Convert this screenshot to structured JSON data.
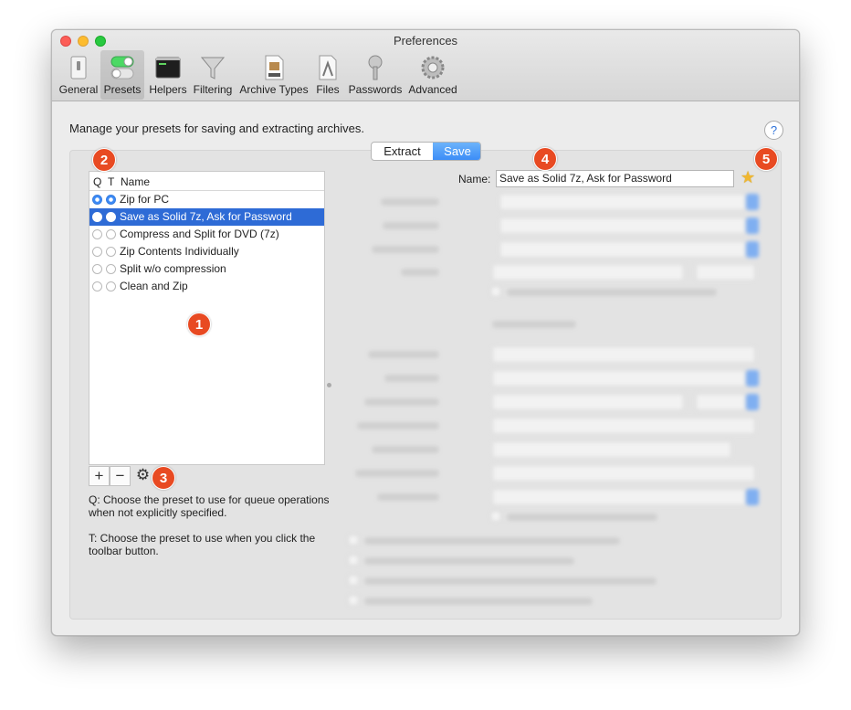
{
  "window": {
    "title": "Preferences"
  },
  "toolbar": {
    "items": [
      {
        "label": "General",
        "icon": "switch-icon"
      },
      {
        "label": "Presets",
        "icon": "toggles-icon",
        "selected": true
      },
      {
        "label": "Helpers",
        "icon": "terminal-icon"
      },
      {
        "label": "Filtering",
        "icon": "funnel-icon"
      },
      {
        "label": "Archive Types",
        "icon": "archive-icon"
      },
      {
        "label": "Files",
        "icon": "file-icon"
      },
      {
        "label": "Passwords",
        "icon": "key-icon"
      },
      {
        "label": "Advanced",
        "icon": "gear-icon"
      }
    ]
  },
  "content": {
    "intro": "Manage your presets for saving and extracting archives.",
    "help_label": "?"
  },
  "segmented": {
    "extract": "Extract",
    "save": "Save",
    "selected": "Save"
  },
  "presets": {
    "headers": {
      "q": "Q",
      "t": "T",
      "name": "Name"
    },
    "rows": [
      {
        "name": "Zip for PC",
        "q": true,
        "t": true
      },
      {
        "name": "Save as Solid 7z, Ask for Password",
        "q": false,
        "t": false,
        "selected": true
      },
      {
        "name": "Compress and Split for DVD (7z)",
        "q": false,
        "t": false
      },
      {
        "name": "Zip Contents Individually",
        "q": false,
        "t": false
      },
      {
        "name": "Split w/o compression",
        "q": false,
        "t": false
      },
      {
        "name": "Clean and Zip",
        "q": false,
        "t": false
      }
    ],
    "add_label": "+",
    "remove_label": "−",
    "gear_label": "⚙"
  },
  "notes": {
    "q": "Q: Choose the preset to use for queue operations when not explicitly specified.",
    "t": "T: Choose the preset to use when you click the toolbar button."
  },
  "editor": {
    "name_label": "Name:",
    "name_value": "Save as Solid 7z, Ask for Password",
    "star": "★"
  },
  "badges": [
    "1",
    "2",
    "3",
    "4",
    "5"
  ],
  "colors": {
    "accent": "#3b8af6",
    "selection": "#2e6bd6",
    "badge": "#e84a22"
  }
}
